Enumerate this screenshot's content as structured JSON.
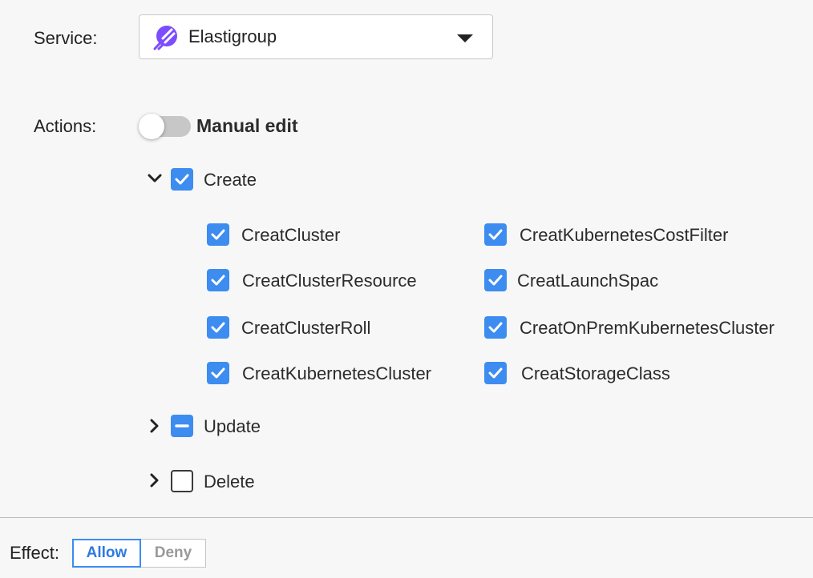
{
  "service": {
    "label": "Service:",
    "selected_value": "Elastigroup",
    "logo_icon": "elastigroup-logo-icon",
    "dropdown_icon": "caret-down-icon"
  },
  "actions": {
    "label": "Actions:",
    "manual_edit": {
      "label": "Manual edit",
      "enabled": false
    },
    "groups": [
      {
        "label": "Create",
        "expanded": true,
        "state": "checked",
        "items": [
          {
            "label": "CreatCluster",
            "checked": true
          },
          {
            "label": "CreatKubernetesCostFilter",
            "checked": true
          },
          {
            "label": "CreatClusterResource",
            "checked": true
          },
          {
            "label": "CreatLaunchSpac",
            "checked": true
          },
          {
            "label": "CreatClusterRoll",
            "checked": true
          },
          {
            "label": "CreatOnPremKubernetesCluster",
            "checked": true
          },
          {
            "label": "CreatKubernetesCluster",
            "checked": true
          },
          {
            "label": "CreatStorageClass",
            "checked": true
          }
        ]
      },
      {
        "label": "Update",
        "expanded": false,
        "state": "partial"
      },
      {
        "label": "Delete",
        "expanded": false,
        "state": "unchecked"
      }
    ]
  },
  "effect": {
    "label": "Effect:",
    "options": [
      "Allow",
      "Deny"
    ],
    "selected": "Allow"
  },
  "colors": {
    "accent": "#3d8cf0",
    "logo": "#7b4dff",
    "toggle_off": "#c7c7c7"
  }
}
